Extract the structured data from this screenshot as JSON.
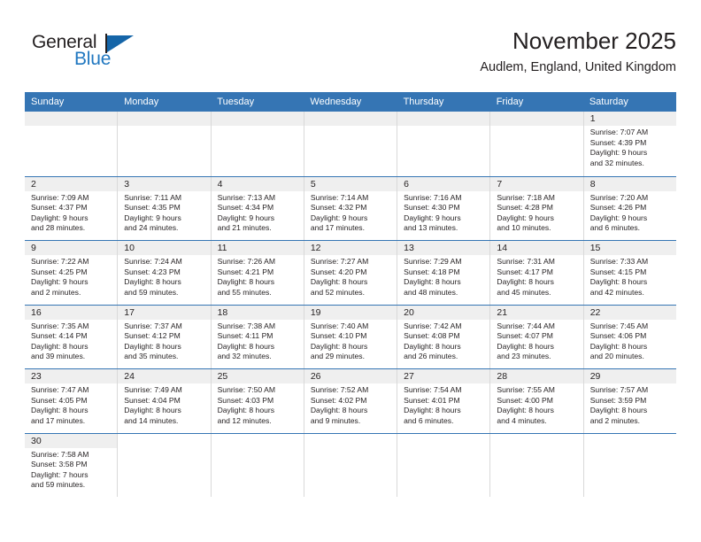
{
  "brand": {
    "name_part1": "General",
    "name_part2": "Blue",
    "color_primary": "#2077c0",
    "color_triangle": "#1565a8"
  },
  "header": {
    "title": "November 2025",
    "subtitle": "Audlem, England, United Kingdom"
  },
  "theme": {
    "header_blue": "#3575b4",
    "day_strip_gray": "#efefef",
    "cell_border": "#d9d9d9"
  },
  "weekdays": [
    "Sunday",
    "Monday",
    "Tuesday",
    "Wednesday",
    "Thursday",
    "Friday",
    "Saturday"
  ],
  "weeks": [
    [
      {
        "empty": true
      },
      {
        "empty": true
      },
      {
        "empty": true
      },
      {
        "empty": true
      },
      {
        "empty": true
      },
      {
        "empty": true
      },
      {
        "day": "1",
        "sunrise": "Sunrise: 7:07 AM",
        "sunset": "Sunset: 4:39 PM",
        "daylight1": "Daylight: 9 hours",
        "daylight2": "and 32 minutes."
      }
    ],
    [
      {
        "day": "2",
        "sunrise": "Sunrise: 7:09 AM",
        "sunset": "Sunset: 4:37 PM",
        "daylight1": "Daylight: 9 hours",
        "daylight2": "and 28 minutes."
      },
      {
        "day": "3",
        "sunrise": "Sunrise: 7:11 AM",
        "sunset": "Sunset: 4:35 PM",
        "daylight1": "Daylight: 9 hours",
        "daylight2": "and 24 minutes."
      },
      {
        "day": "4",
        "sunrise": "Sunrise: 7:13 AM",
        "sunset": "Sunset: 4:34 PM",
        "daylight1": "Daylight: 9 hours",
        "daylight2": "and 21 minutes."
      },
      {
        "day": "5",
        "sunrise": "Sunrise: 7:14 AM",
        "sunset": "Sunset: 4:32 PM",
        "daylight1": "Daylight: 9 hours",
        "daylight2": "and 17 minutes."
      },
      {
        "day": "6",
        "sunrise": "Sunrise: 7:16 AM",
        "sunset": "Sunset: 4:30 PM",
        "daylight1": "Daylight: 9 hours",
        "daylight2": "and 13 minutes."
      },
      {
        "day": "7",
        "sunrise": "Sunrise: 7:18 AM",
        "sunset": "Sunset: 4:28 PM",
        "daylight1": "Daylight: 9 hours",
        "daylight2": "and 10 minutes."
      },
      {
        "day": "8",
        "sunrise": "Sunrise: 7:20 AM",
        "sunset": "Sunset: 4:26 PM",
        "daylight1": "Daylight: 9 hours",
        "daylight2": "and 6 minutes."
      }
    ],
    [
      {
        "day": "9",
        "sunrise": "Sunrise: 7:22 AM",
        "sunset": "Sunset: 4:25 PM",
        "daylight1": "Daylight: 9 hours",
        "daylight2": "and 2 minutes."
      },
      {
        "day": "10",
        "sunrise": "Sunrise: 7:24 AM",
        "sunset": "Sunset: 4:23 PM",
        "daylight1": "Daylight: 8 hours",
        "daylight2": "and 59 minutes."
      },
      {
        "day": "11",
        "sunrise": "Sunrise: 7:26 AM",
        "sunset": "Sunset: 4:21 PM",
        "daylight1": "Daylight: 8 hours",
        "daylight2": "and 55 minutes."
      },
      {
        "day": "12",
        "sunrise": "Sunrise: 7:27 AM",
        "sunset": "Sunset: 4:20 PM",
        "daylight1": "Daylight: 8 hours",
        "daylight2": "and 52 minutes."
      },
      {
        "day": "13",
        "sunrise": "Sunrise: 7:29 AM",
        "sunset": "Sunset: 4:18 PM",
        "daylight1": "Daylight: 8 hours",
        "daylight2": "and 48 minutes."
      },
      {
        "day": "14",
        "sunrise": "Sunrise: 7:31 AM",
        "sunset": "Sunset: 4:17 PM",
        "daylight1": "Daylight: 8 hours",
        "daylight2": "and 45 minutes."
      },
      {
        "day": "15",
        "sunrise": "Sunrise: 7:33 AM",
        "sunset": "Sunset: 4:15 PM",
        "daylight1": "Daylight: 8 hours",
        "daylight2": "and 42 minutes."
      }
    ],
    [
      {
        "day": "16",
        "sunrise": "Sunrise: 7:35 AM",
        "sunset": "Sunset: 4:14 PM",
        "daylight1": "Daylight: 8 hours",
        "daylight2": "and 39 minutes."
      },
      {
        "day": "17",
        "sunrise": "Sunrise: 7:37 AM",
        "sunset": "Sunset: 4:12 PM",
        "daylight1": "Daylight: 8 hours",
        "daylight2": "and 35 minutes."
      },
      {
        "day": "18",
        "sunrise": "Sunrise: 7:38 AM",
        "sunset": "Sunset: 4:11 PM",
        "daylight1": "Daylight: 8 hours",
        "daylight2": "and 32 minutes."
      },
      {
        "day": "19",
        "sunrise": "Sunrise: 7:40 AM",
        "sunset": "Sunset: 4:10 PM",
        "daylight1": "Daylight: 8 hours",
        "daylight2": "and 29 minutes."
      },
      {
        "day": "20",
        "sunrise": "Sunrise: 7:42 AM",
        "sunset": "Sunset: 4:08 PM",
        "daylight1": "Daylight: 8 hours",
        "daylight2": "and 26 minutes."
      },
      {
        "day": "21",
        "sunrise": "Sunrise: 7:44 AM",
        "sunset": "Sunset: 4:07 PM",
        "daylight1": "Daylight: 8 hours",
        "daylight2": "and 23 minutes."
      },
      {
        "day": "22",
        "sunrise": "Sunrise: 7:45 AM",
        "sunset": "Sunset: 4:06 PM",
        "daylight1": "Daylight: 8 hours",
        "daylight2": "and 20 minutes."
      }
    ],
    [
      {
        "day": "23",
        "sunrise": "Sunrise: 7:47 AM",
        "sunset": "Sunset: 4:05 PM",
        "daylight1": "Daylight: 8 hours",
        "daylight2": "and 17 minutes."
      },
      {
        "day": "24",
        "sunrise": "Sunrise: 7:49 AM",
        "sunset": "Sunset: 4:04 PM",
        "daylight1": "Daylight: 8 hours",
        "daylight2": "and 14 minutes."
      },
      {
        "day": "25",
        "sunrise": "Sunrise: 7:50 AM",
        "sunset": "Sunset: 4:03 PM",
        "daylight1": "Daylight: 8 hours",
        "daylight2": "and 12 minutes."
      },
      {
        "day": "26",
        "sunrise": "Sunrise: 7:52 AM",
        "sunset": "Sunset: 4:02 PM",
        "daylight1": "Daylight: 8 hours",
        "daylight2": "and 9 minutes."
      },
      {
        "day": "27",
        "sunrise": "Sunrise: 7:54 AM",
        "sunset": "Sunset: 4:01 PM",
        "daylight1": "Daylight: 8 hours",
        "daylight2": "and 6 minutes."
      },
      {
        "day": "28",
        "sunrise": "Sunrise: 7:55 AM",
        "sunset": "Sunset: 4:00 PM",
        "daylight1": "Daylight: 8 hours",
        "daylight2": "and 4 minutes."
      },
      {
        "day": "29",
        "sunrise": "Sunrise: 7:57 AM",
        "sunset": "Sunset: 3:59 PM",
        "daylight1": "Daylight: 8 hours",
        "daylight2": "and 2 minutes."
      }
    ],
    [
      {
        "day": "30",
        "sunrise": "Sunrise: 7:58 AM",
        "sunset": "Sunset: 3:58 PM",
        "daylight1": "Daylight: 7 hours",
        "daylight2": "and 59 minutes."
      },
      {
        "blank": true
      },
      {
        "blank": true
      },
      {
        "blank": true
      },
      {
        "blank": true
      },
      {
        "blank": true
      },
      {
        "blank": true
      }
    ]
  ]
}
